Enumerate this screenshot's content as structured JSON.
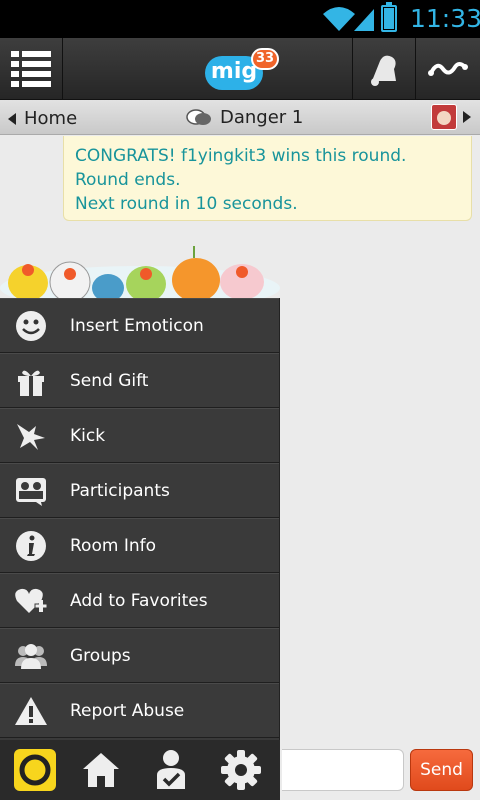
{
  "status_bar": {
    "time": "11:33",
    "wifi_icon": "wifi-icon",
    "signal_icon": "signal-icon",
    "battery_icon": "battery-icon",
    "accent": "#33b5e5"
  },
  "action_bar": {
    "logo_text": "mig",
    "logo_badge": "33",
    "menu_icon": "list-menu-icon",
    "bell_icon": "bell-icon",
    "wave_icon": "wave-icon"
  },
  "sub_bar": {
    "back_label": "Home",
    "title": "Danger 1",
    "chat_icon": "chat-bubble-icon"
  },
  "message": {
    "lines": [
      "CONGRATS! f1yingkit3 wins this round.",
      "Round ends.",
      "Next round in 10 seconds."
    ],
    "color": "#18949b",
    "background": "#fdf8d8"
  },
  "menu": {
    "items": [
      {
        "label": "Insert Emoticon",
        "icon": "smiley-icon"
      },
      {
        "label": "Send Gift",
        "icon": "gift-icon"
      },
      {
        "label": "Kick",
        "icon": "kick-icon"
      },
      {
        "label": "Participants",
        "icon": "participants-icon"
      },
      {
        "label": "Room Info",
        "icon": "info-icon"
      },
      {
        "label": "Add to Favorites",
        "icon": "heart-add-icon"
      },
      {
        "label": "Groups",
        "icon": "groups-icon"
      },
      {
        "label": "Report Abuse",
        "icon": "warning-icon"
      }
    ]
  },
  "bottom_bar": {
    "icons": [
      "mig-ring-icon",
      "home-icon",
      "profile-check-icon",
      "settings-gear-icon"
    ],
    "ring_color": "#f7d51d"
  },
  "input": {
    "value": "",
    "placeholder": ""
  },
  "send_button": {
    "label": "Send",
    "color": "#f05a2a"
  }
}
